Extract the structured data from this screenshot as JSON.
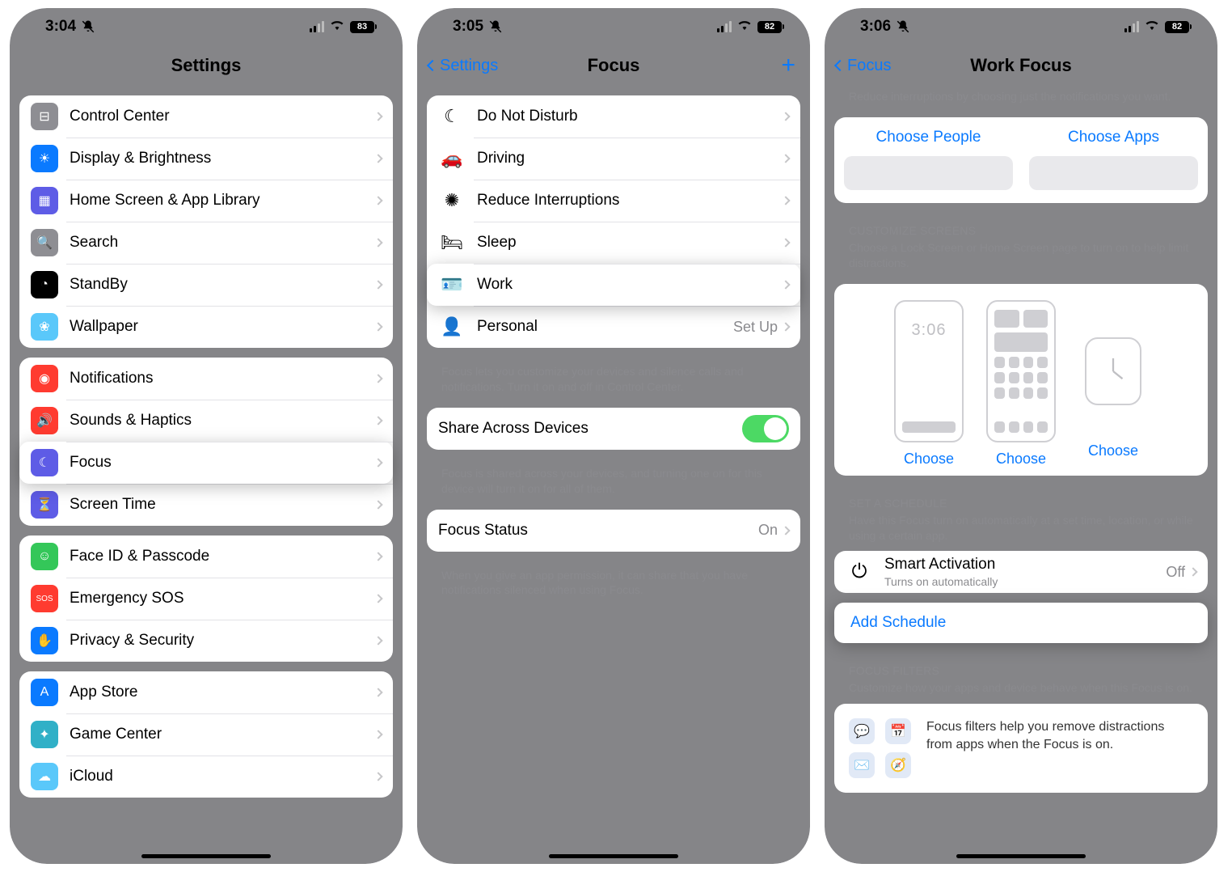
{
  "panel1": {
    "time": "3:04",
    "battery": "83",
    "title": "Settings",
    "groups": [
      [
        {
          "key": "control-center",
          "label": "Control Center",
          "color": "c-grey",
          "glyph": "⊟"
        },
        {
          "key": "display",
          "label": "Display & Brightness",
          "color": "c-blue",
          "glyph": "☀"
        },
        {
          "key": "home-screen",
          "label": "Home Screen & App Library",
          "color": "c-indigo",
          "glyph": "▦"
        },
        {
          "key": "search",
          "label": "Search",
          "color": "c-grey",
          "glyph": "🔍"
        },
        {
          "key": "standby",
          "label": "StandBy",
          "color": "c-black",
          "glyph": "◔"
        },
        {
          "key": "wallpaper",
          "label": "Wallpaper",
          "color": "c-lightblue",
          "glyph": "❀"
        }
      ],
      [
        {
          "key": "notifications",
          "label": "Notifications",
          "color": "c-red",
          "glyph": "◉"
        },
        {
          "key": "sounds",
          "label": "Sounds & Haptics",
          "color": "c-red",
          "glyph": "🔊"
        },
        {
          "key": "focus",
          "label": "Focus",
          "color": "c-indigo",
          "glyph": "☾",
          "highlight": true
        },
        {
          "key": "screen-time",
          "label": "Screen Time",
          "color": "c-indigo",
          "glyph": "⏳"
        }
      ],
      [
        {
          "key": "faceid",
          "label": "Face ID & Passcode",
          "color": "c-green",
          "glyph": "☺"
        },
        {
          "key": "sos",
          "label": "Emergency SOS",
          "color": "c-red",
          "glyph": "SOS"
        },
        {
          "key": "privacy",
          "label": "Privacy & Security",
          "color": "c-blue",
          "glyph": "✋"
        }
      ],
      [
        {
          "key": "appstore",
          "label": "App Store",
          "color": "c-blue",
          "glyph": "A"
        },
        {
          "key": "gamecenter",
          "label": "Game Center",
          "color": "c-teal",
          "glyph": "✦"
        },
        {
          "key": "icloud",
          "label": "iCloud",
          "color": "c-lightblue",
          "glyph": "☁"
        }
      ]
    ]
  },
  "panel2": {
    "time": "3:05",
    "battery": "82",
    "back": "Settings",
    "title": "Focus",
    "list": [
      {
        "key": "dnd",
        "label": "Do Not Disturb",
        "color": "fi-purple",
        "glyph": "☾"
      },
      {
        "key": "driving",
        "label": "Driving",
        "color": "fi-blue",
        "glyph": "🚗"
      },
      {
        "key": "reduce",
        "label": "Reduce Interruptions",
        "color": "fi-lav",
        "glyph": "✺"
      },
      {
        "key": "sleep",
        "label": "Sleep",
        "color": "fi-mint",
        "glyph": "🛏"
      },
      {
        "key": "work",
        "label": "Work",
        "color": "fi-teal",
        "glyph": "🪪",
        "highlight": true
      },
      {
        "key": "personal",
        "label": "Personal",
        "color": "fi-lav",
        "glyph": "👤",
        "value": "Set Up"
      }
    ],
    "list_footer": "Focus lets you customize your devices and silence calls and notifications. Turn it on and off in Control Center.",
    "share_label": "Share Across Devices",
    "share_footer": "Focus is shared across your devices, and turning one on for this device will turn it on for all of them.",
    "status_label": "Focus Status",
    "status_value": "On",
    "status_footer": "When you give an app permission, it can share that you have notifications silenced when using Focus."
  },
  "panel3": {
    "time": "3:06",
    "battery": "82",
    "back": "Focus",
    "title": "Work Focus",
    "notify_footer": "Reduce interruptions by choosing just the notifications you want.",
    "choose_people": "Choose People",
    "choose_apps": "Choose Apps",
    "customize_header": "CUSTOMIZE SCREENS",
    "customize_sub": "Choose a Lock Screen or Home Screen page to turn on to help limit distractions.",
    "thumb_clock": "3:06",
    "choose_label": "Choose",
    "schedule_header": "SET A SCHEDULE",
    "schedule_sub": "Have this Focus turn on automatically at a set time, location, or while using a certain app.",
    "smart_label": "Smart Activation",
    "smart_sub": "Turns on automatically",
    "smart_value": "Off",
    "add_schedule": "Add Schedule",
    "filters_header": "FOCUS FILTERS",
    "filters_sub": "Customize how your apps and device behave when this Focus is on.",
    "filters_text": "Focus filters help you remove distractions from apps when the Focus is on."
  }
}
